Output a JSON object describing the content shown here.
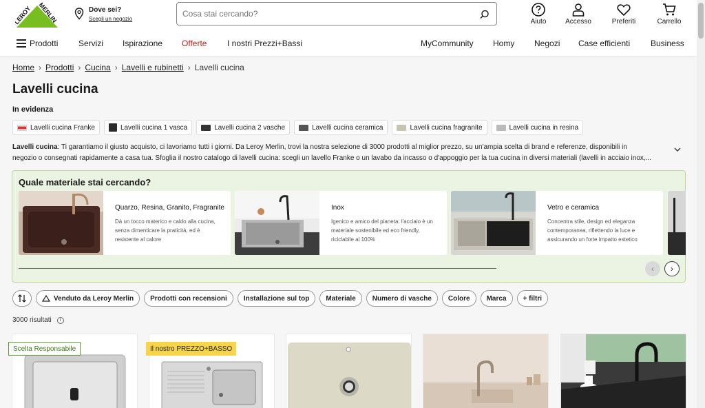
{
  "header": {
    "logo_line1": "LEROY",
    "logo_line2": "MERLIN",
    "where_title": "Dove sei?",
    "where_link": "Scegli un negozio",
    "search_placeholder": "Cosa stai cercando?",
    "util": [
      {
        "label": "Aiuto",
        "icon": "help-icon"
      },
      {
        "label": "Accesso",
        "icon": "user-icon"
      },
      {
        "label": "Preferiti",
        "icon": "heart-icon"
      },
      {
        "label": "Carrello",
        "icon": "cart-icon"
      }
    ]
  },
  "nav": {
    "left": [
      "Prodotti",
      "Servizi",
      "Ispirazione",
      "Offerte",
      "I nostri Prezzi+Bassi"
    ],
    "right": [
      "MyCommunity",
      "Homy",
      "Negozi",
      "Case efficienti",
      "Business"
    ]
  },
  "breadcrumb": [
    "Home",
    "Prodotti",
    "Cucina",
    "Lavelli e rubinetti",
    "Lavelli cucina"
  ],
  "page_title": "Lavelli cucina",
  "in_evidenza": "In evidenza",
  "chips": [
    "Lavelli cucina Franke",
    "Lavelli cucina 1 vasca",
    "Lavelli cucina 2 vasche",
    "Lavelli cucina ceramica",
    "Lavelli cucina fragranite",
    "Lavelli cucina in resina"
  ],
  "description": {
    "lead": "Lavelli cucina",
    "text": ": Ti garantiamo il giusto acquisto, ci lavoriamo tutti i giorni. Da Leroy Merlin, trovi la nostra selezione di 3000 prodotti al miglior prezzo, su un'ampia scelta di brand e referenze, disponibili in negozio o consegnati rapidamente a casa tua. Sfoglia il nostro catalogo di lavelli cucina: scegli un lavello Franke o un lavabo da incasso o d'appoggio per la tua cucina in diversi materiali (lavelli in acciaio inox,..."
  },
  "material": {
    "title": "Quale materiale stai cercando?",
    "cards": [
      {
        "title": "Quarzo, Resina, Granito, Fragranite",
        "desc": "Dà un tocco materico e caldo alla cucina, senza dimenticare la praticità, ed è resistente al calore"
      },
      {
        "title": "Inox",
        "desc": "Igenico e amico del pianeta: l'acciaio è un materiale sostenibile ed eco friendly, riciclabile al 100%"
      },
      {
        "title": "Vetro e ceramica",
        "desc": "Concentra stile, design ed eleganza contemporanea, riflettendo la luce e assicurando un forte impatto estetico"
      }
    ]
  },
  "filters": [
    "Venduto da Leroy Merlin",
    "Prodotti con recensioni",
    "Installazione sul top",
    "Materiale",
    "Numero di vasche",
    "Colore",
    "Marca",
    "+ filtri"
  ],
  "results": "3000 risultati",
  "badges": {
    "green": "Scelta Responsabile",
    "yellow": "Il nostro PREZZO+BASSO"
  },
  "colors": {
    "brand_green": "#78be20",
    "offer_red": "#c01c1c",
    "material_bg": "#ebf4e2"
  }
}
